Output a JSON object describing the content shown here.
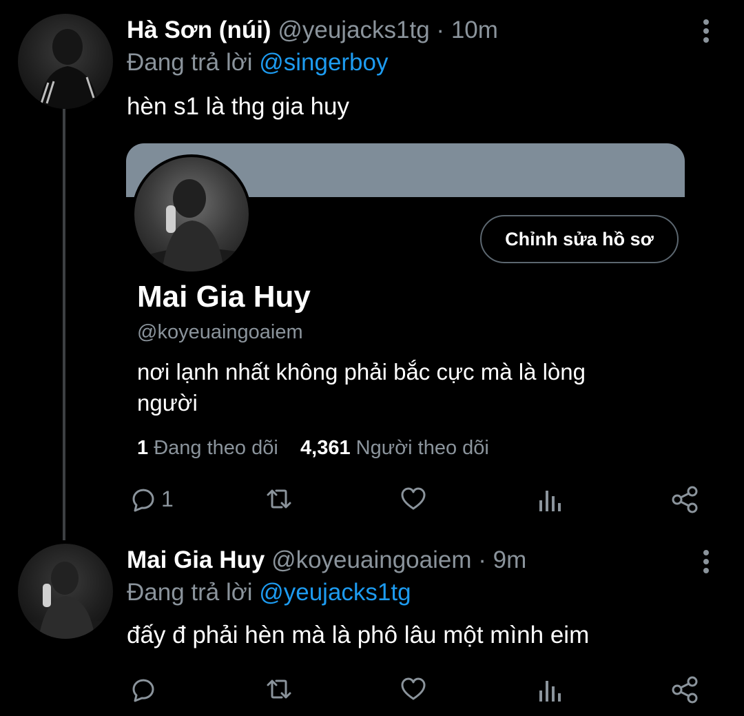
{
  "tweet1": {
    "name": "Hà Sơn (núi)",
    "handle": "@yeujacks1tg",
    "separator": "·",
    "time": "10m",
    "reply_prefix": "Đang trả lời",
    "reply_to": "@singerboy",
    "text": "hèn s1 là thg gia huy",
    "reply_count": "1"
  },
  "profile_card": {
    "name": "Mai Gia Huy",
    "handle": "@koyeuaingoaiem",
    "bio": "nơi lạnh nhất không phải bắc cực mà là lòng người",
    "edit_button": "Chỉnh sửa hồ sơ",
    "following_count": "1",
    "following_label": "Đang theo dõi",
    "followers_count": "4,361",
    "followers_label": "Người theo dõi"
  },
  "tweet2": {
    "name": "Mai Gia Huy",
    "handle": "@koyeuaingoaiem",
    "separator": "·",
    "time": "9m",
    "reply_prefix": "Đang trả lời",
    "reply_to": "@yeujacks1tg",
    "text": "đấy đ phải hèn mà là phô lâu một mình eim"
  },
  "colors": {
    "background": "#000000",
    "secondary_text": "#8b949c",
    "mention": "#1d9bf0",
    "banner": "#7f8d99"
  },
  "icons": [
    "reply-icon",
    "retweet-icon",
    "like-icon",
    "analytics-icon",
    "share-icon",
    "more-icon"
  ]
}
